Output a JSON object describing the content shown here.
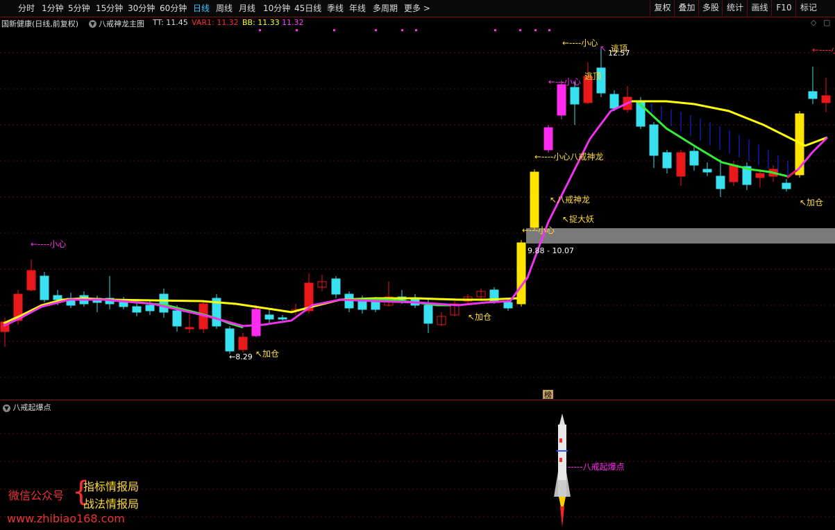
{
  "toolbar": {
    "timeframes": [
      {
        "label": "分时",
        "active": false
      },
      {
        "label": "1分钟",
        "active": false
      },
      {
        "label": "5分钟",
        "active": false
      },
      {
        "label": "15分钟",
        "active": false
      },
      {
        "label": "30分钟",
        "active": false
      },
      {
        "label": "60分钟",
        "active": false
      },
      {
        "label": "日线",
        "active": true
      },
      {
        "label": "周线",
        "active": false
      },
      {
        "label": "月线",
        "active": false
      },
      {
        "label": "10分钟",
        "active": false
      },
      {
        "label": "45日线",
        "active": false
      },
      {
        "label": "季线",
        "active": false
      },
      {
        "label": "年线",
        "active": false
      },
      {
        "label": "多周期",
        "active": false
      },
      {
        "label": "更多 >",
        "active": false
      }
    ],
    "tools": [
      "复权",
      "叠加",
      "多股",
      "统计",
      "画线",
      "F10",
      "标记"
    ]
  },
  "info": {
    "stock": "国新健康(日线,前复权)",
    "indicator": "八戒神龙主图",
    "tt": "TT: 11.45",
    "var1": "VAR1: 11.32",
    "bb": "BB: 11.33",
    "bb2": "11.32"
  },
  "annotations": {
    "careful": "←----小心",
    "careful_short": "←---小心",
    "escape": "逃顶",
    "high": "12.57",
    "bajie": "八戒神龙",
    "careful_bajie": "←----小心八戒神龙",
    "catch": "↖捉大妖",
    "add": "↖加仓",
    "low": "←8.29",
    "zone": "9.88 - 10.07",
    "bang": "榜"
  },
  "sub": {
    "title": "八戒起爆点",
    "label": "-----八戒起爆点"
  },
  "watermark": {
    "wechat": "微信公众号",
    "name1": "指标情报局",
    "name2": "战法情报局",
    "url": "www.zhibiao168.com"
  },
  "colors": {
    "up": "#e8191a",
    "down": "#39e0f0",
    "limitup": "#ffe400",
    "rise": "#ff2cf0",
    "yellow_line": "#ffff00",
    "green_line": "#33ee33",
    "magenta_line": "#ee33ee"
  }
}
